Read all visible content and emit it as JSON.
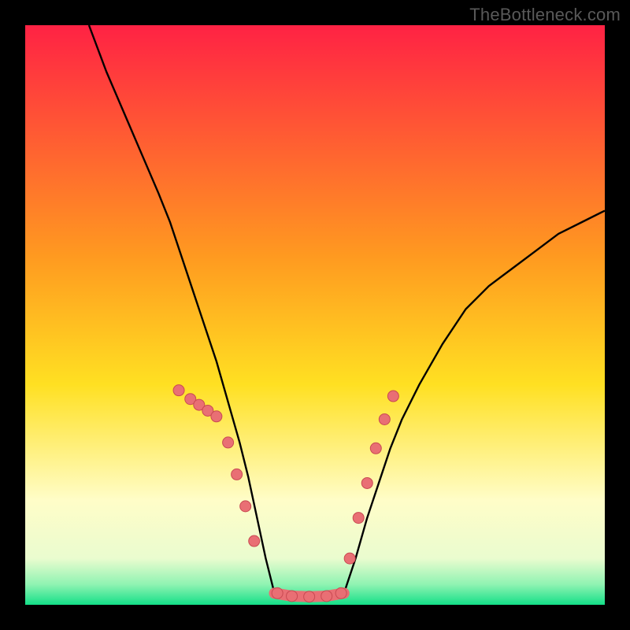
{
  "watermark": "TheBottleneck.com",
  "colors": {
    "frame": "#000000",
    "gradient_top": "#ff2244",
    "gradient_mid1": "#ff6a2a",
    "gradient_mid2": "#ffd820",
    "gradient_mid3": "#fffcbf",
    "gradient_bottom": "#24e08e",
    "curve": "#000000",
    "point_fill": "#e96f74",
    "point_stroke": "#c94a52"
  },
  "chart_data": {
    "type": "line",
    "title": "",
    "xlabel": "",
    "ylabel": "",
    "xlim": [
      0,
      100
    ],
    "ylim": [
      0,
      100
    ],
    "series": [
      {
        "name": "left_branch",
        "x": [
          11,
          14,
          17,
          20,
          23,
          25,
          27,
          29,
          31,
          33,
          35,
          37,
          38.5,
          40,
          41.5,
          43
        ],
        "y": [
          100,
          92,
          85,
          78,
          71,
          66,
          60,
          54,
          48,
          42,
          35,
          28,
          22,
          15,
          8,
          2
        ]
      },
      {
        "name": "valley_floor",
        "x": [
          43,
          46,
          49,
          52,
          55
        ],
        "y": [
          2,
          1.5,
          1.4,
          1.5,
          2
        ]
      },
      {
        "name": "right_branch",
        "x": [
          55,
          57,
          59,
          61,
          63,
          65,
          68,
          72,
          76,
          80,
          84,
          88,
          92,
          96,
          100
        ],
        "y": [
          2,
          8,
          15,
          21,
          27,
          32,
          38,
          45,
          51,
          55,
          58,
          61,
          64,
          66,
          68
        ]
      }
    ],
    "scatter_points": {
      "name": "data_points",
      "x": [
        26.5,
        28.5,
        30,
        31.5,
        33,
        35,
        36.5,
        38,
        39.5,
        43.5,
        46,
        49,
        52,
        54.5,
        56,
        57.5,
        59,
        60.5,
        62,
        63.5
      ],
      "y": [
        37,
        35.5,
        34.5,
        33.5,
        32.5,
        28,
        22.5,
        17,
        11,
        2,
        1.5,
        1.4,
        1.5,
        2,
        8,
        15,
        21,
        27,
        32,
        36
      ]
    },
    "gradient_stops": [
      {
        "offset": 0.0,
        "color": "#ff2244"
      },
      {
        "offset": 0.4,
        "color": "#ff9a20"
      },
      {
        "offset": 0.62,
        "color": "#ffe022"
      },
      {
        "offset": 0.82,
        "color": "#fffdc8"
      },
      {
        "offset": 0.92,
        "color": "#eafccf"
      },
      {
        "offset": 0.965,
        "color": "#8ff3b2"
      },
      {
        "offset": 1.0,
        "color": "#14df88"
      }
    ]
  }
}
